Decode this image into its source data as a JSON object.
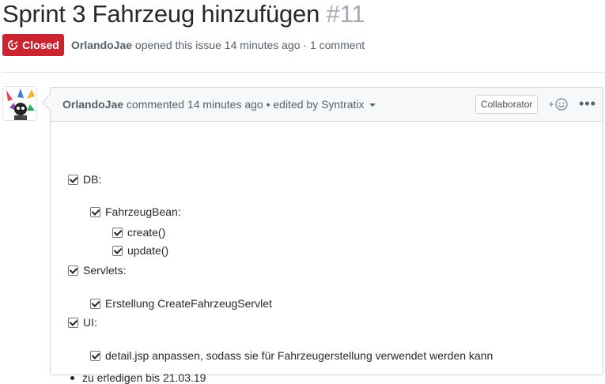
{
  "issue": {
    "title": "Sprint 3 Fahrzeug hinzufügen",
    "number": "#11",
    "state": "Closed",
    "author": "OrlandoJae",
    "meta_text": "opened this issue 14 minutes ago · 1 comment"
  },
  "comment": {
    "author": "OrlandoJae",
    "header_text": "commented 14 minutes ago • edited by Syntratix",
    "role_badge": "Collaborator",
    "reaction_icon": "smiley-icon",
    "more_icon": "kebab-horizontal-icon",
    "body": {
      "db": "DB:",
      "fahrzeugbean": "FahrzeugBean:",
      "create": "create()",
      "update": "update()",
      "servlets": "Servlets:",
      "servlet_item": "Erstellung CreateFahrzeugServlet",
      "ui": "UI:",
      "ui_item": "detail.jsp anpassen, sodass sie für Fahrzeugerstellung verwendet werden kann",
      "deadline": "zu erledigen bis 21.03.19"
    }
  },
  "colors": {
    "closed_badge": "#cb2431",
    "header_bg": "#f6f8fa",
    "border": "#d1d5da"
  }
}
